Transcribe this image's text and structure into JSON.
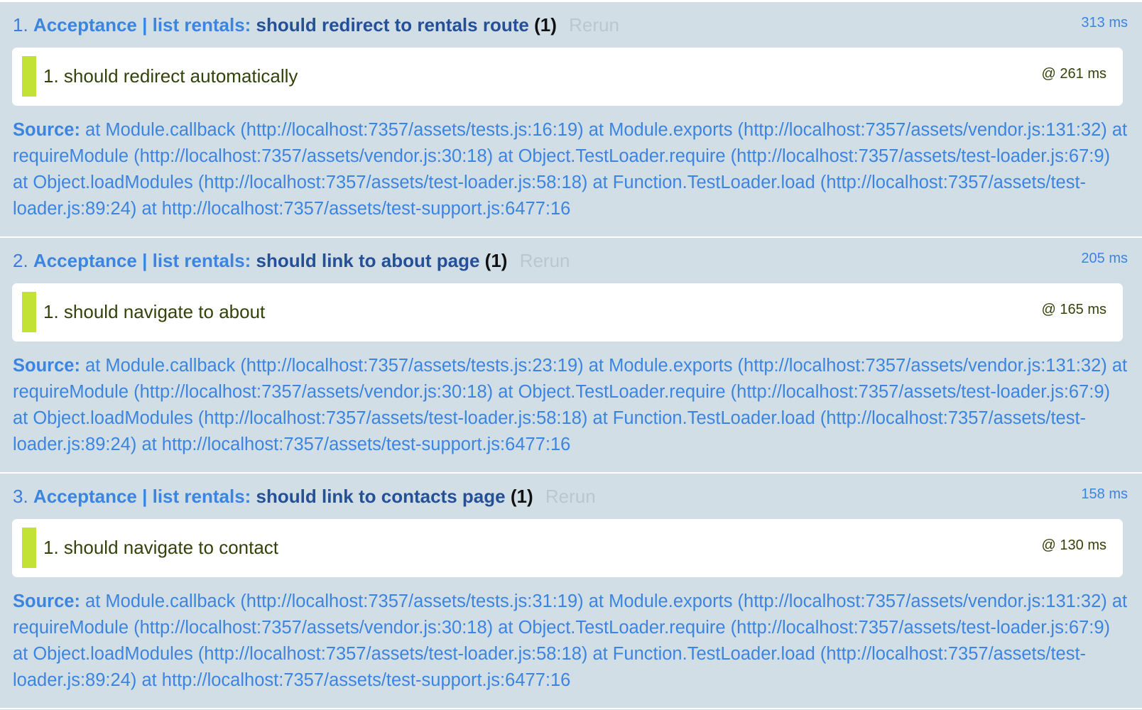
{
  "tests": [
    {
      "number": "1.",
      "module": "Acceptance | list rentals:",
      "name": "should redirect to rentals route",
      "counts": "(1)",
      "rerun_label": "Rerun",
      "runtime": "313 ms",
      "assertion": {
        "number": "1.",
        "message": "should redirect automatically",
        "time": "@ 261 ms"
      },
      "source_label": "Source:",
      "source_text": " at Module.callback (http://localhost:7357/assets/tests.js:16:19) at Module.exports (http://localhost:7357/assets/vendor.js:131:32) at requireModule (http://localhost:7357/assets/vendor.js:30:18) at Object.TestLoader.require (http://localhost:7357/assets/test-loader.js:67:9) at Object.loadModules (http://localhost:7357/assets/test-loader.js:58:18) at Function.TestLoader.load (http://localhost:7357/assets/test-loader.js:89:24) at http://localhost:7357/assets/test-support.js:6477:16"
    },
    {
      "number": "2.",
      "module": "Acceptance | list rentals:",
      "name": "should link to about page",
      "counts": "(1)",
      "rerun_label": "Rerun",
      "runtime": "205 ms",
      "assertion": {
        "number": "1.",
        "message": "should navigate to about",
        "time": "@ 165 ms"
      },
      "source_label": "Source:",
      "source_text": " at Module.callback (http://localhost:7357/assets/tests.js:23:19) at Module.exports (http://localhost:7357/assets/vendor.js:131:32) at requireModule (http://localhost:7357/assets/vendor.js:30:18) at Object.TestLoader.require (http://localhost:7357/assets/test-loader.js:67:9) at Object.loadModules (http://localhost:7357/assets/test-loader.js:58:18) at Function.TestLoader.load (http://localhost:7357/assets/test-loader.js:89:24) at http://localhost:7357/assets/test-support.js:6477:16"
    },
    {
      "number": "3.",
      "module": "Acceptance | list rentals:",
      "name": "should link to contacts page",
      "counts": "(1)",
      "rerun_label": "Rerun",
      "runtime": "158 ms",
      "assertion": {
        "number": "1.",
        "message": "should navigate to contact",
        "time": "@ 130 ms"
      },
      "source_label": "Source:",
      "source_text": " at Module.callback (http://localhost:7357/assets/tests.js:31:19) at Module.exports (http://localhost:7357/assets/vendor.js:131:32) at requireModule (http://localhost:7357/assets/vendor.js:30:18) at Object.TestLoader.require (http://localhost:7357/assets/test-loader.js:67:9) at Object.loadModules (http://localhost:7357/assets/test-loader.js:58:18) at Function.TestLoader.load (http://localhost:7357/assets/test-loader.js:89:24) at http://localhost:7357/assets/test-support.js:6477:16"
    }
  ],
  "colors": {
    "background": "#d2dee6",
    "module": "#3b85e0",
    "test_name": "#245097",
    "rerun": "#b9c7d1",
    "pass_bar": "#c2e235",
    "assert_text": "#33420a"
  }
}
